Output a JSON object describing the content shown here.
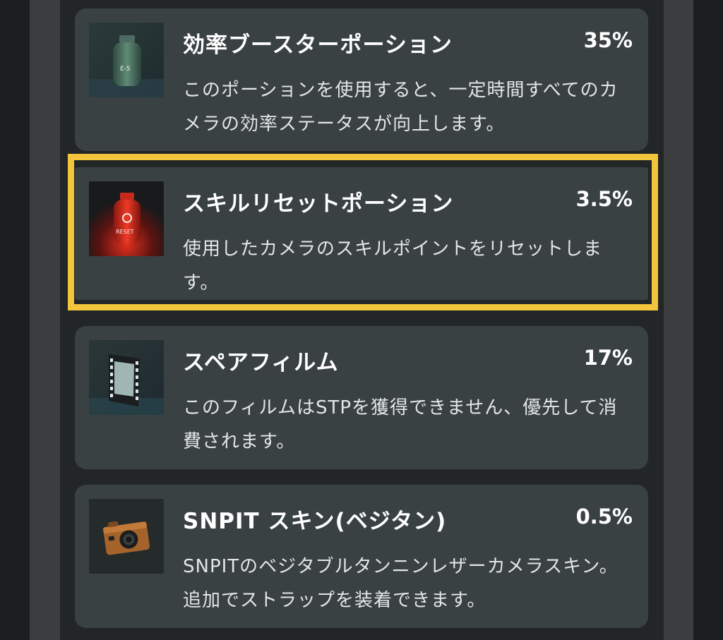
{
  "items": [
    {
      "title": "効率ブースターポーション",
      "rate": "35%",
      "description": "このポーションを使用すると、一定時間すべてのカメラの効率ステータスが向上します。",
      "icon": "green-potion-bottle-icon",
      "label": "E-5"
    },
    {
      "title": "スキルリセットポーション",
      "rate": "3.5%",
      "description": "使用したカメラのスキルポイントをリセットします。",
      "icon": "red-potion-bottle-icon",
      "label": "RESET",
      "highlighted": true
    },
    {
      "title": "スペアフィルム",
      "rate": "17%",
      "description": "このフィルムはSTPを獲得できません、優先して消費されます。",
      "icon": "film-strip-icon"
    },
    {
      "title": "SNPIT スキン(ベジタン)",
      "rate": "0.5%",
      "description": "SNPITのベジタブルタンニンレザーカメラスキン。追加でストラップを装着できます。",
      "icon": "camera-icon"
    }
  ],
  "colors": {
    "highlight": "#f2c53d",
    "card": "#3a4142",
    "background": "#232627"
  }
}
